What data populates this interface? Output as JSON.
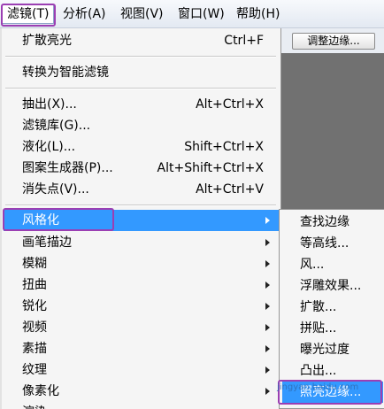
{
  "menubar": {
    "items": [
      "滤镜(T)",
      "分析(A)",
      "视图(V)",
      "窗口(W)",
      "帮助(H)"
    ]
  },
  "toolbar": {
    "refine_edge_label": "调整边缘..."
  },
  "filter_menu": {
    "top": [
      {
        "label": "扩散亮光",
        "shortcut": "Ctrl+F"
      }
    ],
    "smart": [
      {
        "label": "转换为智能滤镜",
        "shortcut": ""
      }
    ],
    "special": [
      {
        "label": "抽出(X)...",
        "shortcut": "Alt+Ctrl+X"
      },
      {
        "label": "滤镜库(G)...",
        "shortcut": ""
      },
      {
        "label": "液化(L)...",
        "shortcut": "Shift+Ctrl+X"
      },
      {
        "label": "图案生成器(P)...",
        "shortcut": "Alt+Shift+Ctrl+X"
      },
      {
        "label": "消失点(V)...",
        "shortcut": "Alt+Ctrl+V"
      }
    ],
    "categories": [
      "风格化",
      "画笔描边",
      "模糊",
      "扭曲",
      "锐化",
      "视频",
      "素描",
      "纹理",
      "像素化",
      "渲染"
    ]
  },
  "stylize_submenu": {
    "items": [
      "查找边缘",
      "等高线...",
      "风...",
      "浮雕效果...",
      "扩散...",
      "拼贴...",
      "曝光过度",
      "凸出...",
      "照亮边缘..."
    ]
  },
  "watermark": "jingyan.baidu.com"
}
